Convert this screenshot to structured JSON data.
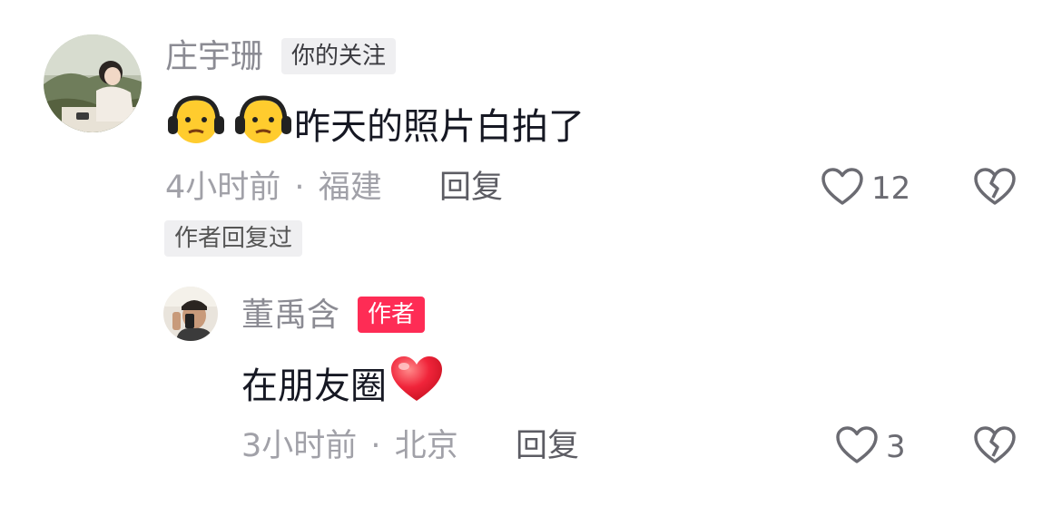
{
  "comment": {
    "username": "庄宇珊",
    "follow_tag": "你的关注",
    "text": "昨天的照片白拍了",
    "emojis": [
      "headphone-sad-emoji",
      "headphone-sad-emoji"
    ],
    "time": "4小时前",
    "separator": "·",
    "location": "福建",
    "reply_label": "回复",
    "like_count": "12",
    "author_replied_tag": "作者回复过"
  },
  "reply": {
    "username": "董禹含",
    "author_tag": "作者",
    "text": "在朋友圈",
    "emoji": "red-heart-emoji",
    "time": "3小时前",
    "separator": "·",
    "location": "北京",
    "reply_label": "回复",
    "like_count": "3"
  },
  "colors": {
    "author_tag": "#fe2c55",
    "username": "#8b8b93",
    "meta": "#a1a1a8",
    "text": "#161823"
  }
}
